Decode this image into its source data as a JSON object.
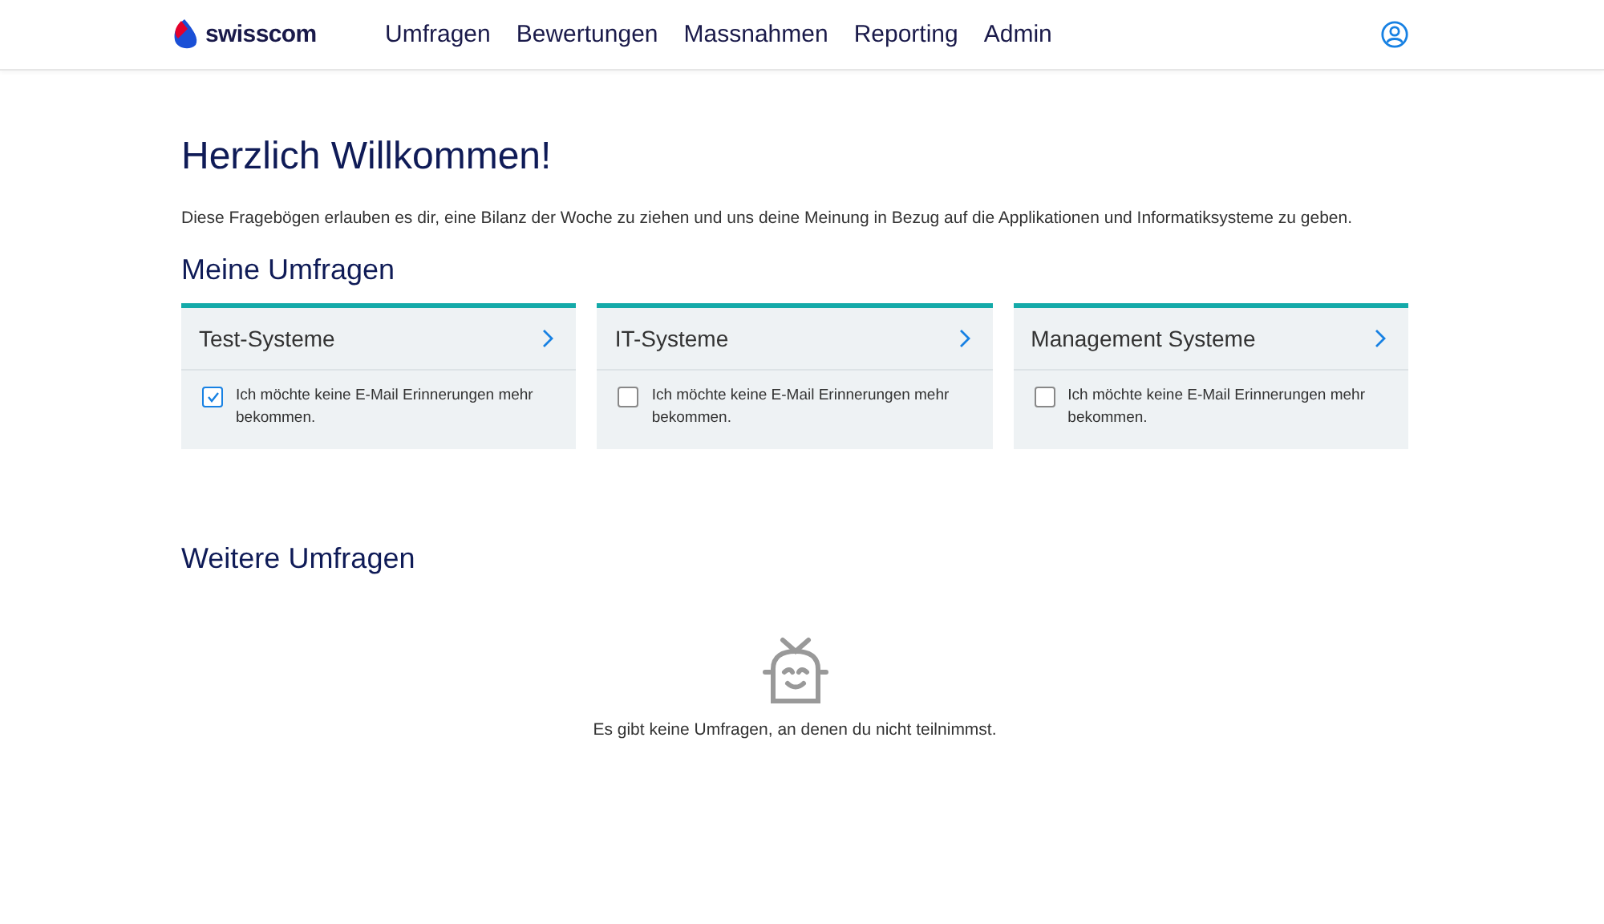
{
  "header": {
    "logo": "swisscom",
    "nav": [
      {
        "label": "Umfragen"
      },
      {
        "label": "Bewertungen"
      },
      {
        "label": "Massnahmen"
      },
      {
        "label": "Reporting"
      },
      {
        "label": "Admin"
      }
    ]
  },
  "title": "Herzlich Willkommen!",
  "intro": "Diese Fragebögen erlauben es dir, eine Bilanz der Woche zu ziehen und uns deine Meinung in Bezug auf die Applikationen und Informatiksysteme zu geben.",
  "my_surveys": {
    "heading": "Meine Umfragen",
    "cards": [
      {
        "title": "Test-Systeme",
        "option": "Ich möchte keine E-Mail Erinnerungen mehr bekommen.",
        "checked": true
      },
      {
        "title": "IT-Systeme",
        "option": "Ich möchte keine E-Mail Erinnerungen mehr bekommen.",
        "checked": false
      },
      {
        "title": "Management Systeme",
        "option": "Ich möchte keine E-Mail Erinnerungen mehr bekommen.",
        "checked": false
      }
    ]
  },
  "more_surveys": {
    "heading": "Weitere Umfragen",
    "empty_text": "Es gibt keine Umfragen, an denen du nicht teilnimmst."
  }
}
